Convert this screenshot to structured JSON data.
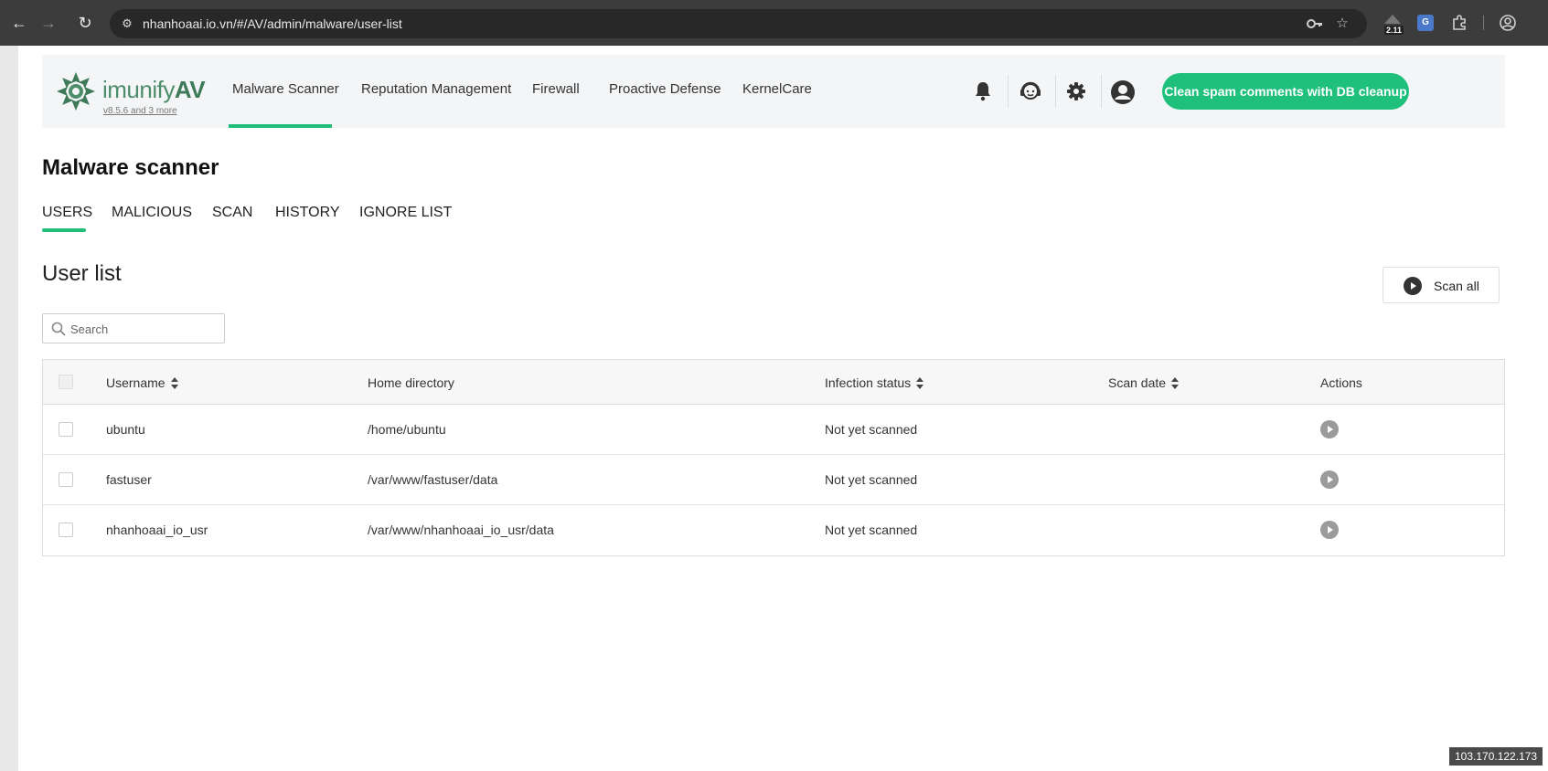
{
  "browser": {
    "url": "nhanhoaai.io.vn/#/AV/admin/malware/user-list",
    "extension_badge": "2.11",
    "translate_label": "G",
    "icons": [
      "back-icon",
      "forward-icon",
      "reload-icon",
      "site-info-icon",
      "key-icon",
      "star-icon",
      "extension-icon",
      "puzzle-icon",
      "profile-icon"
    ]
  },
  "header": {
    "brand_light": "imunify",
    "brand_bold": "AV",
    "version": "v8.5.6 and 3 more",
    "nav": [
      {
        "label": "Malware Scanner",
        "active": true
      },
      {
        "label": "Reputation Management"
      },
      {
        "label": "Firewall"
      },
      {
        "label": "Proactive Defense"
      },
      {
        "label": "KernelCare"
      }
    ],
    "cta_label": "Clean spam comments with DB cleanup",
    "accent_color": "#1fc07c"
  },
  "main": {
    "title": "Malware scanner",
    "tabs": [
      {
        "label": "USERS",
        "active": true
      },
      {
        "label": "MALICIOUS"
      },
      {
        "label": "SCAN"
      },
      {
        "label": "HISTORY"
      },
      {
        "label": "IGNORE LIST"
      }
    ],
    "section_title": "User list",
    "scan_all_label": "Scan all",
    "search_placeholder": "Search"
  },
  "table": {
    "columns": [
      "Username",
      "Home directory",
      "Infection status",
      "Scan date",
      "Actions"
    ],
    "rows": [
      {
        "username": "ubuntu",
        "home": "/home/ubuntu",
        "status": "Not yet scanned",
        "scan_date": ""
      },
      {
        "username": "fastuser",
        "home": "/var/www/fastuser/data",
        "status": "Not yet scanned",
        "scan_date": ""
      },
      {
        "username": "nhanhoaai_io_usr",
        "home": "/var/www/nhanhoaai_io_usr/data",
        "status": "Not yet scanned",
        "scan_date": ""
      }
    ]
  },
  "footer": {
    "ip": "103.170.122.173"
  }
}
